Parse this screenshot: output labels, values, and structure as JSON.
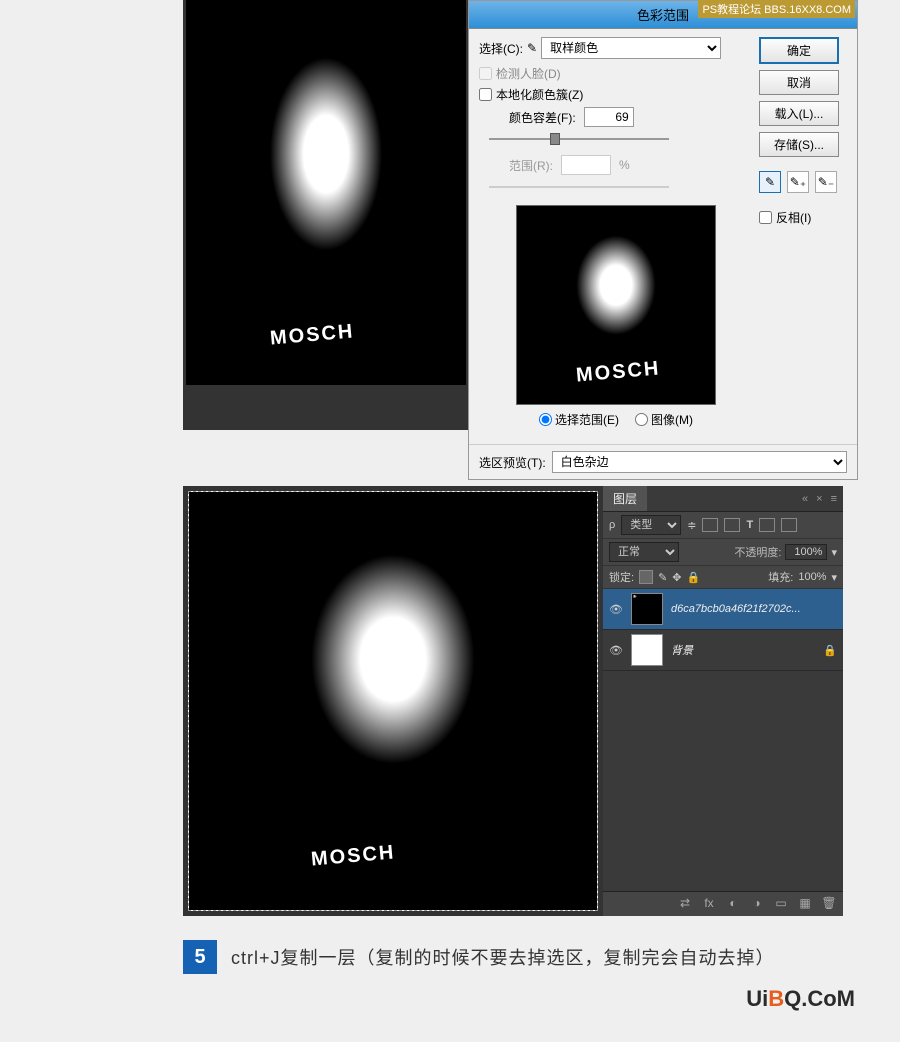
{
  "watermark_top": "PS教程论坛\nBBS.16XX8.COM",
  "dialog": {
    "title": "色彩范围",
    "select_label": "选择(C):",
    "select_value": "取样颜色",
    "detect_faces": "检测人脸(D)",
    "localized": "本地化颜色簇(Z)",
    "fuzziness_label": "颜色容差(F):",
    "fuzziness_value": "69",
    "range_label": "范围(R):",
    "range_value": "",
    "range_unit": "%",
    "radio_selection": "选择范围(E)",
    "radio_image": "图像(M)",
    "sel_preview_label": "选区预览(T):",
    "sel_preview_value": "白色杂边",
    "ok": "确定",
    "cancel": "取消",
    "load": "载入(L)...",
    "save": "存储(S)...",
    "invert": "反相(I)"
  },
  "layers": {
    "tab": "图层",
    "type_label": "类型",
    "blend_mode": "正常",
    "opacity_label": "不透明度:",
    "opacity_value": "100%",
    "lock_label": "锁定:",
    "fill_label": "填充:",
    "fill_value": "100%",
    "layer1_name": "d6ca7bcb0a46f21f2702c...",
    "layer2_name": "背景"
  },
  "step": {
    "num": "5",
    "text": "ctrl+J复制一层（复制的时候不要去掉选区，复制完会自动去掉）"
  },
  "logo": {
    "u": "U",
    "i": "i",
    "b": "B",
    "q": "Q.CoM"
  }
}
